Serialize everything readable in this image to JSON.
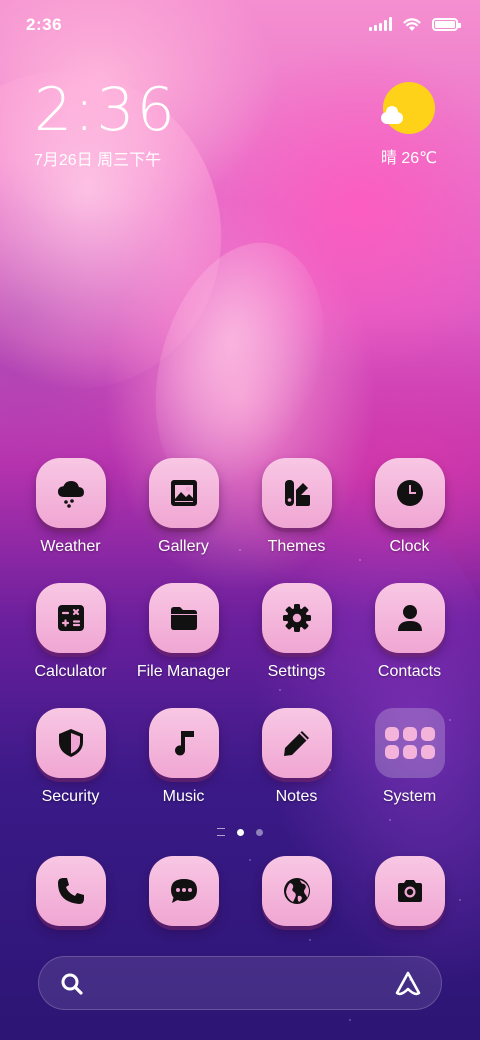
{
  "status_bar": {
    "time": "2:36"
  },
  "clock_widget": {
    "time": "2:36",
    "date": "7月26日 周三下午"
  },
  "weather_widget": {
    "condition_temp": "晴 26℃",
    "icon": "sunny-partly-cloudy-icon"
  },
  "apps": [
    {
      "label": "Weather",
      "icon": "cloud-rain-icon"
    },
    {
      "label": "Gallery",
      "icon": "image-icon"
    },
    {
      "label": "Themes",
      "icon": "themes-icon"
    },
    {
      "label": "Clock",
      "icon": "clock-icon"
    },
    {
      "label": "Calculator",
      "icon": "calculator-icon"
    },
    {
      "label": "File Manager",
      "icon": "folder-icon"
    },
    {
      "label": "Settings",
      "icon": "gear-icon"
    },
    {
      "label": "Contacts",
      "icon": "person-icon"
    },
    {
      "label": "Security",
      "icon": "shield-icon"
    },
    {
      "label": "Music",
      "icon": "music-note-icon"
    },
    {
      "label": "Notes",
      "icon": "pencil-icon"
    },
    {
      "label": "System",
      "icon": "folder-grid-icon"
    }
  ],
  "dock": [
    {
      "icon": "phone-icon"
    },
    {
      "icon": "message-icon"
    },
    {
      "icon": "globe-icon"
    },
    {
      "icon": "camera-icon"
    }
  ],
  "page_indicator": {
    "pages": 2,
    "active": 1
  },
  "search_bar": {
    "search_icon": "search-icon",
    "assistant_icon": "assistant-icon"
  },
  "colors": {
    "icon_bg": "#f3b3da",
    "icon_glyph": "#111111",
    "sun": "#ffd21a"
  }
}
